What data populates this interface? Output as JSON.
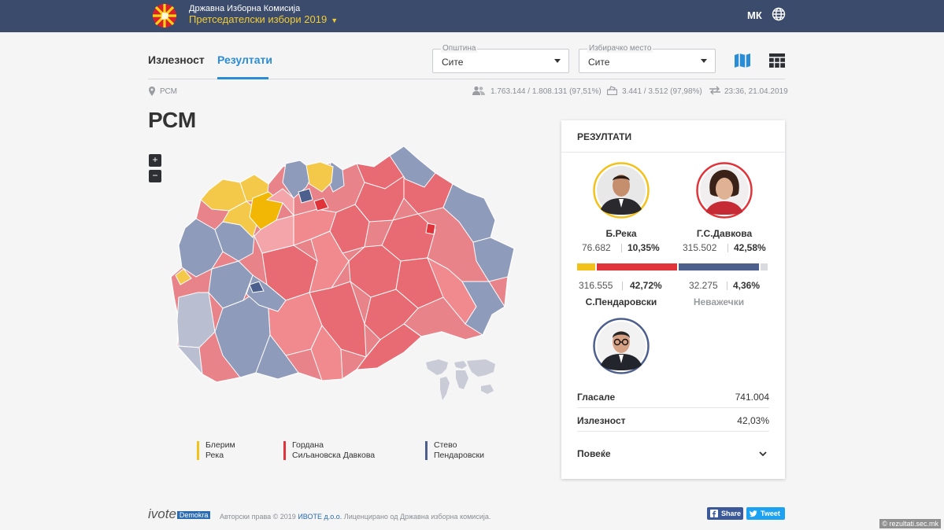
{
  "header": {
    "org": "Државна Изборна Комисија",
    "election": "Претседателски избори 2019",
    "lang": "МК"
  },
  "tabs": {
    "turnout": "Излезност",
    "results": "Резултати"
  },
  "filters": {
    "municipality": {
      "label": "Општина",
      "value": "Сите"
    },
    "polling_station": {
      "label": "Избирачко место",
      "value": "Сите"
    }
  },
  "info": {
    "breadcrumb": "РСМ",
    "voters": "1.763.144 / 1.808.131 (97,51%)",
    "stations": "3.441 / 3.512 (97,98%)",
    "updated": "23:36, 21.04.2019"
  },
  "page_title": "РСМ",
  "zoom": {
    "in": "+",
    "out": "−"
  },
  "legend": [
    {
      "line1": "Блерим",
      "line2": "Река",
      "color": "#f2c21b"
    },
    {
      "line1": "Гордана",
      "line2": "Сиљановска Давкова",
      "color": "#e0343a"
    },
    {
      "line1": "Стево",
      "line2": "Пендаровски",
      "color": "#4d5f8c"
    }
  ],
  "results": {
    "title": "РЕЗУЛТАТИ",
    "candidates": [
      {
        "name": "Б.Река",
        "votes": "76.682",
        "pct": "10,35%",
        "share": 10.35,
        "color": "#f2c21b"
      },
      {
        "name": "Г.С.Давкова",
        "votes": "315.502",
        "pct": "42,58%",
        "share": 42.58,
        "color": "#e0343a"
      },
      {
        "name": "С.Пендаровски",
        "votes": "316.555",
        "pct": "42,72%",
        "share": 42.72,
        "color": "#4d5f8c"
      },
      {
        "name": "Неважечки",
        "votes": "32.275",
        "pct": "4,36%",
        "share": 4.36,
        "color": "#d9dbe0"
      }
    ],
    "summary": [
      {
        "label": "Гласале",
        "value": "741.004"
      },
      {
        "label": "Излезност",
        "value": "42,03%"
      }
    ],
    "more": "Повеќе"
  },
  "footer": {
    "logo": "ivote",
    "logo_brand": "Demokra",
    "copyright_prefix": "Авторски права © 2019",
    "company": "ИВОТЕ д.о.о.",
    "copyright_suffix": "Лиценцирано од Државна изборна комисија.",
    "share": "Share",
    "tweet": "Tweet"
  },
  "credit": "© rezultati.sec.mk"
}
